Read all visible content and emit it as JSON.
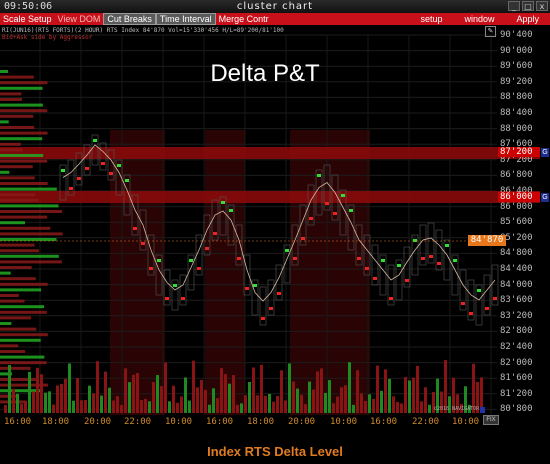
{
  "window": {
    "clock": "09:50:06",
    "title": "cluster chart",
    "buttons": [
      "_",
      "□",
      "x"
    ]
  },
  "menu": {
    "left": [
      "Scale Setup",
      "View DOM",
      "Cut Breaks",
      "Time Interval",
      "Merge Contr"
    ],
    "right": [
      "setup",
      "window",
      "Apply"
    ]
  },
  "info": {
    "line1": "RI(JUN16)(RTS FORTS)(2 HOUR) RTS Index 84'870 Vol=15'330'456 H/L=89'200/81'100",
    "line2": "Bid+Ask side by Aggressor"
  },
  "chart_title": "Delta P&T",
  "caption": "Index RTS Delta Level",
  "copyright": "©2016 NAVIGATOR",
  "fix_label": "FIX",
  "price_labels": [
    "90'400",
    "90'000",
    "89'600",
    "89'200",
    "88'800",
    "88'400",
    "88'000",
    "87'600",
    "87'200",
    "86'800",
    "86'400",
    "86'000",
    "85'600",
    "85'200",
    "84'800",
    "84'400",
    "84'000",
    "83'600",
    "83'200",
    "82'800",
    "82'400",
    "82'000",
    "81'600",
    "81'200",
    "80'800"
  ],
  "levels": [
    {
      "price": "87'200",
      "tag": "G"
    },
    {
      "price": "86'000",
      "tag": "G"
    }
  ],
  "current_price": "84'870",
  "time_labels": [
    "16:00",
    "18:00",
    "20:00",
    "22:00",
    "10:00",
    "16:00",
    "18:00",
    "20:00",
    "10:00",
    "16:00",
    "22:00",
    "10:00"
  ],
  "colors": {
    "menu_bg": "#c8101a",
    "level_band": "#8a0a0a",
    "current_price": "#e8761a",
    "caption": "#e07b20",
    "bull": "#22aa22",
    "bear": "#cc2020"
  }
}
